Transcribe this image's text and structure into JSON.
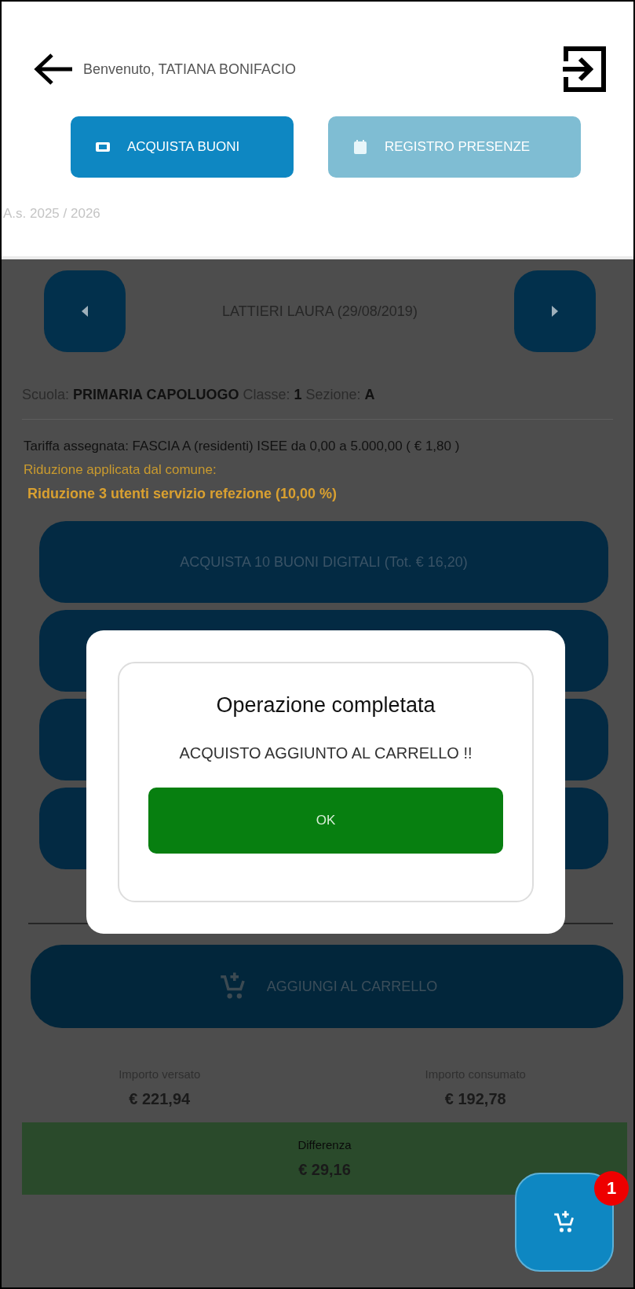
{
  "header": {
    "greeting": "Benvenuto, TATIANA BONIFACIO",
    "tabs": [
      {
        "label": "ACQUISTA BUONI",
        "kind": "purchase",
        "selected": true
      },
      {
        "label": "REGISTRO PRESENZE",
        "kind": "attendance",
        "selected": false
      }
    ],
    "school_year": "A.s. 2025 / 2026"
  },
  "student": {
    "name": "LATTIERI LAURA (29/08/2019)",
    "school": "Scuola: **PRIMARIA CAPOLUOGO**  Classe: **1**  Sezione: **A**",
    "tariff": "Tariffa assegnata: FASCIA A (residenti) ISEE da 0,00 a 5.000,00 ( € 1,80 )",
    "reduction_label": "Riduzione applicata dal comune:",
    "reduction": "Riduzione 3 utenti servizio refezione  (10,00 %)"
  },
  "purchase_options": [
    {
      "kind": "visible",
      "label": "ACQUISTA 10 BUONI DIGITALI  (Tot. € 16,20)"
    },
    {
      "kind": "covered"
    },
    {
      "kind": "covered"
    },
    {
      "kind": "covered"
    }
  ],
  "add_to_cart": "AGGIUNGI AL CARRELLO",
  "totals": {
    "paid_label": "Importo versato",
    "paid": "€ 221,94",
    "consumed_label": "Importo consumato",
    "consumed": "€ 192,78",
    "difference_label": "Differenza",
    "difference": "€ 29,16"
  },
  "cart_badge": "1",
  "dialog": {
    "title": "Operazione completata",
    "message": "ACQUISTO AGGIUNTO AL CARRELLO !!",
    "button": "OK"
  }
}
